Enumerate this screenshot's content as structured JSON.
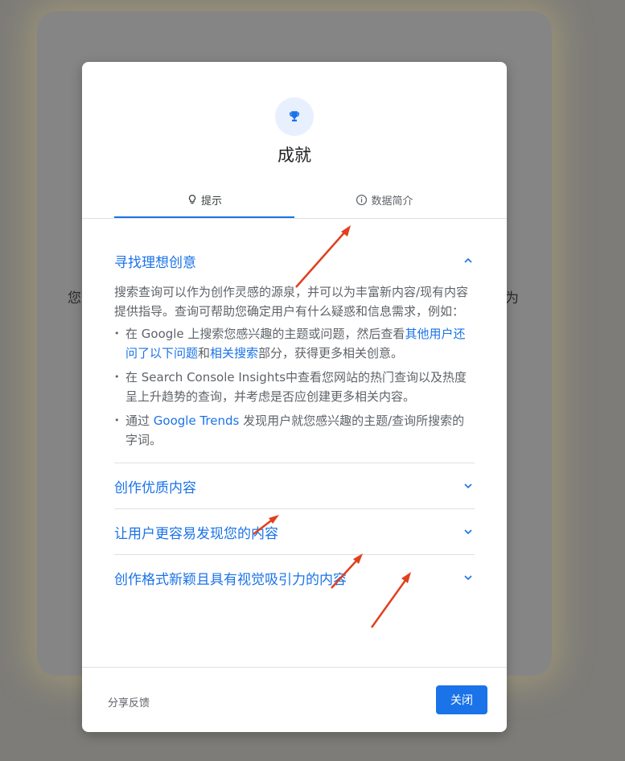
{
  "background": {
    "left_text": "您",
    "right_text": "为"
  },
  "dialog": {
    "icon": "trophy-icon",
    "title": "成就",
    "tabs": [
      {
        "label": "提示",
        "icon": "lightbulb-icon",
        "active": true
      },
      {
        "label": "数据简介",
        "icon": "info-icon",
        "active": false
      }
    ],
    "sections": [
      {
        "title": "寻找理想创意",
        "expanded": true,
        "intro": "搜索查询可以作为创作灵感的源泉，并可以为丰富新内容/现有内容提供指导。查询可帮助您确定用户有什么疑惑和信息需求，例如：",
        "bullets": [
          {
            "p1": "在 Google 上搜索您感兴趣的主题或问题，然后查看",
            "link1": "其他用户还问了以下问题",
            "p2": "和",
            "link2": "相关搜索",
            "p3": "部分，获得更多相关创意。"
          },
          {
            "p1": "在 Search Console Insights中查看您网站的热门查询以及热度呈上升趋势的查询，并考虑是否应创建更多相关内容。"
          },
          {
            "p1": "通过 ",
            "link1": "Google Trends",
            "p2": " 发现用户就您感兴趣的主题/查询所搜索的字词。"
          }
        ]
      },
      {
        "title": "创作优质内容",
        "expanded": false
      },
      {
        "title": "让用户更容易发现您的内容",
        "expanded": false
      },
      {
        "title": "创作格式新颖且具有视觉吸引力的内容",
        "expanded": false
      }
    ],
    "footer": {
      "feedback": "分享反馈",
      "close": "关闭"
    }
  },
  "colors": {
    "accent": "#1a73e8",
    "annotation_arrow": "#e0401f"
  }
}
